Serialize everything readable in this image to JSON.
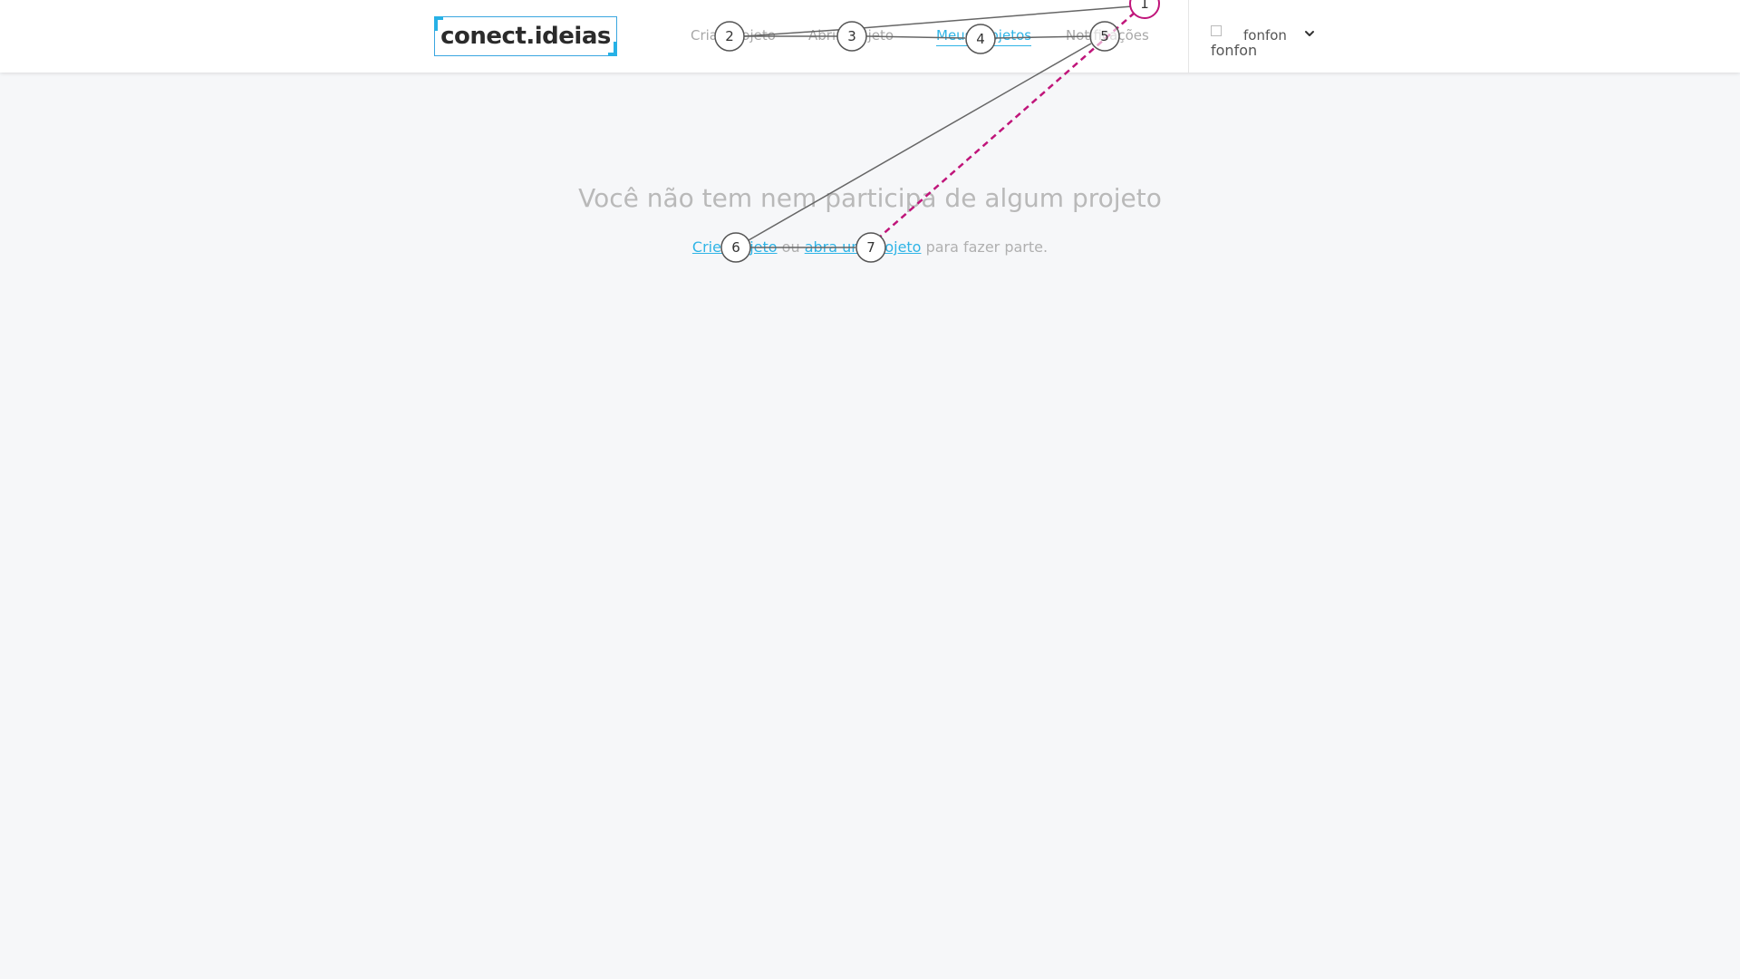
{
  "header": {
    "logo_text": "conect.ideias",
    "nav": [
      {
        "label": "Criar projeto"
      },
      {
        "label": "Abrir projeto"
      },
      {
        "label": "Meus projetos"
      },
      {
        "label": "Notificações"
      }
    ],
    "user": {
      "name": "fonfon",
      "avatar_alt": "fonfon"
    }
  },
  "main": {
    "empty_title": "Você não tem nem participa de algum projeto",
    "create_link": "Crie projeto",
    "separator": "ou",
    "join_link": "abra um projeto",
    "suffix": "para fazer parte."
  },
  "annotations": {
    "markers": [
      "1",
      "2",
      "3",
      "4",
      "5",
      "6",
      "7"
    ],
    "colors": {
      "line": "#666666",
      "highlight": "#c0157a"
    }
  },
  "colors": {
    "accent": "#2fb4e6",
    "muted_text": "#b9b9b9",
    "background": "#f6f7f9"
  }
}
